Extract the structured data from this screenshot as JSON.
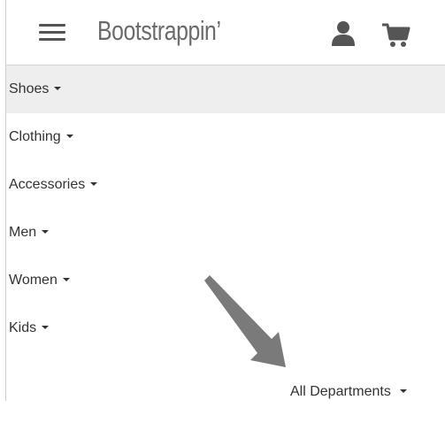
{
  "navbar": {
    "brand": "Bootstrappin’",
    "icons": [
      "hamburger-menu-icon",
      "user-icon",
      "cart-icon"
    ]
  },
  "menu": {
    "items": [
      {
        "label": "Shoes",
        "active": true
      },
      {
        "label": "Clothing",
        "active": false
      },
      {
        "label": "Accessories",
        "active": false
      },
      {
        "label": "Men",
        "active": false
      },
      {
        "label": "Women",
        "active": false
      },
      {
        "label": "Kids",
        "active": false
      }
    ]
  },
  "dropdown": {
    "label": "All Departments"
  },
  "colors": {
    "active_bg": "#eeeeee",
    "text": "#333333",
    "brand": "#6b6b6b",
    "arrow": "#7a7a7a"
  }
}
